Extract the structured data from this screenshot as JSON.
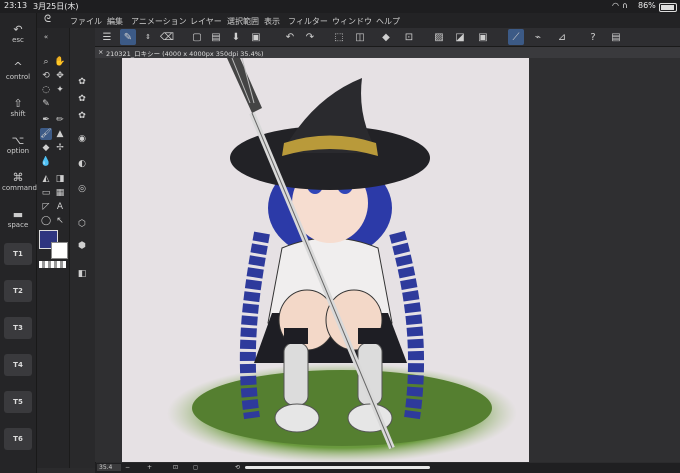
{
  "status": {
    "time": "23:13",
    "date": "3月25日(木)",
    "battery": "86%"
  },
  "menu": [
    "ファイル",
    "編集",
    "アニメーション",
    "レイヤー",
    "選択範囲",
    "表示",
    "フィルター",
    "ウィンドウ",
    "ヘルプ"
  ],
  "modifier_keys": [
    {
      "name": "esc",
      "glyph": "↶"
    },
    {
      "name": "control",
      "glyph": "^"
    },
    {
      "name": "shift",
      "glyph": "⇧"
    },
    {
      "name": "option",
      "glyph": "⌥"
    },
    {
      "name": "command",
      "glyph": "⌘"
    },
    {
      "name": "space",
      "glyph": "▬"
    }
  ],
  "touch_buttons": [
    "T1",
    "T2",
    "T3",
    "T4",
    "T5",
    "T6"
  ],
  "document_tab": "210321_ロキシー (4000 x 4000px 350dpi 35.4%)",
  "zoom": "35.4",
  "colors": {
    "main_color": "#2e3580",
    "sub_color": "#ffffff",
    "accent": "#3c5a86"
  }
}
